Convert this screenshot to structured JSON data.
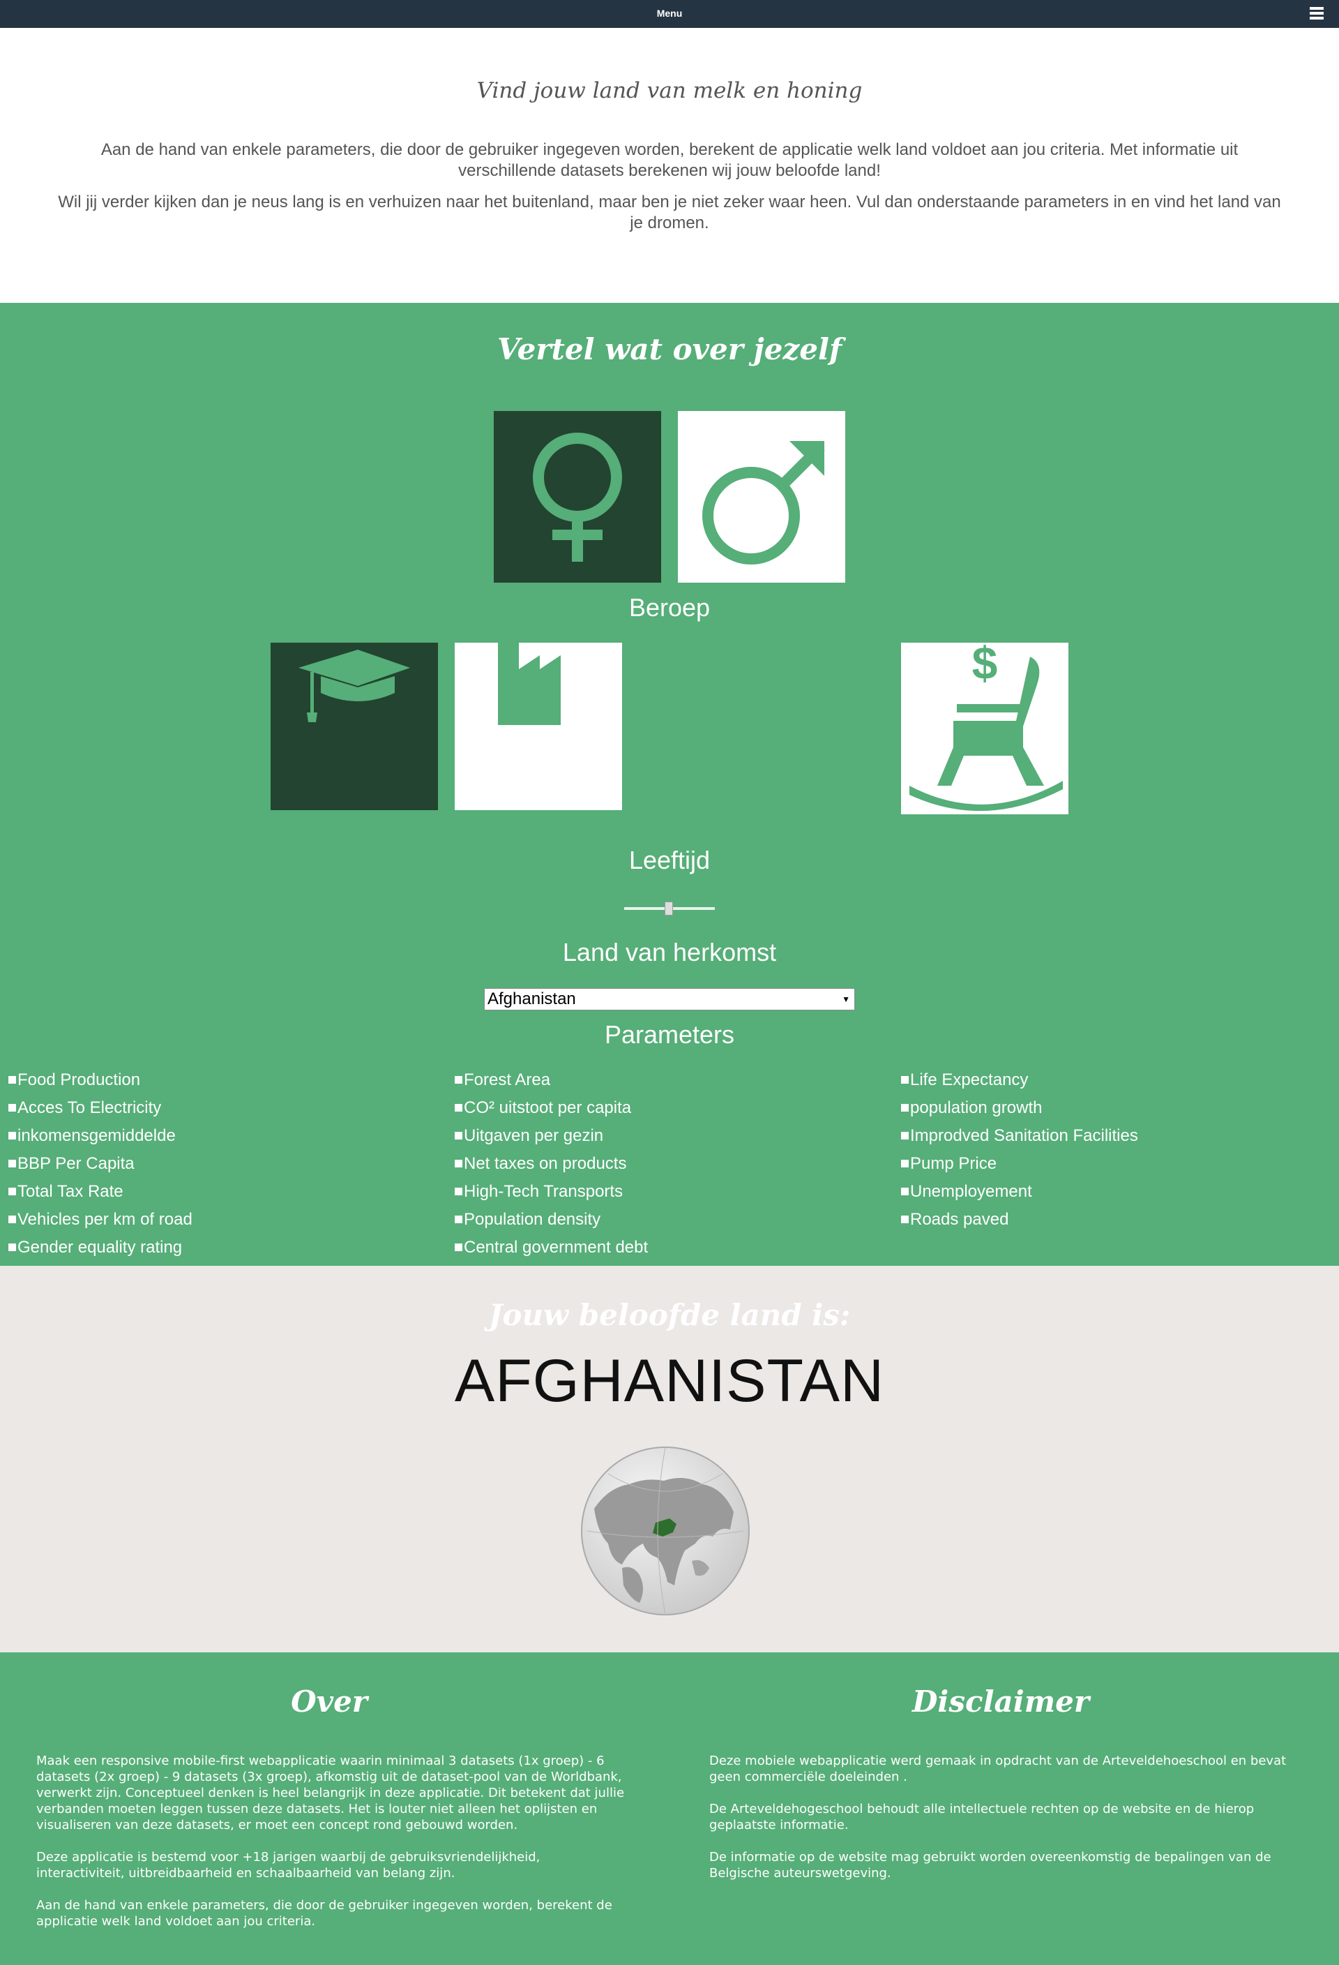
{
  "nav": {
    "menu_label": "Menu",
    "menu_icon": "hamburger-icon"
  },
  "intro": {
    "title": "Vind jouw land van melk en honing",
    "paragraph1": "Aan de hand van enkele parameters, die door de gebruiker ingegeven worden, berekent de applicatie welk land voldoet aan jou criteria. Met informatie uit verschillende datasets berekenen wij jouw beloofde land!",
    "paragraph2": "Wil jij verder kijken dan je neus lang is en verhuizen naar het buitenland, maar ben je niet zeker waar heen. Vul dan onderstaande parameters in en vind het land van je dromen."
  },
  "form": {
    "title": "Vertel wat over jezelf",
    "gender_options": [
      {
        "icon": "female-symbol-icon",
        "selected": true
      },
      {
        "icon": "male-symbol-icon",
        "selected": false
      }
    ],
    "profession_heading": "Beroep",
    "profession_options": [
      {
        "icon": "graduation-cap-icon",
        "selected": true
      },
      {
        "icon": "factory-icon",
        "selected": false
      },
      {
        "icon": "retirement-rocking-chair-icon",
        "selected": false
      }
    ],
    "age_heading": "Leeftijd",
    "age_slider_value": 0.5,
    "origin_heading": "Land van herkomst",
    "origin_selected": "Afghanistan",
    "parameters_heading": "Parameters",
    "parameters": [
      [
        "Food Production",
        "Acces To Electricity",
        "inkomensgemiddelde",
        "BBP Per Capita",
        "Total Tax Rate",
        "Vehicles per km of road",
        "Gender equality rating"
      ],
      [
        "Forest Area",
        "CO² uitstoot per capita",
        "Uitgaven per gezin",
        "Net taxes on products",
        "High-Tech Transports",
        "Population density",
        "Central government debt"
      ],
      [
        "Life Expectancy",
        "population growth",
        "Improdved Sanitation Facilities",
        "Pump Price",
        "Unemployement",
        "Roads paved"
      ]
    ]
  },
  "result": {
    "label": "Jouw beloofde land is:",
    "country": "AFGHANISTAN",
    "globe_icon": "globe-afghanistan-icon"
  },
  "footer": {
    "about_title": "Over",
    "about_paragraphs": [
      "Maak een responsive mobile-first webapplicatie waarin minimaal 3 datasets (1x groep) - 6 datasets (2x groep) - 9 datasets (3x groep), afkomstig uit de dataset-pool van de Worldbank, verwerkt zijn. Conceptueel denken is heel belangrijk in deze applicatie. Dit betekent dat jullie verbanden moeten leggen tussen deze datasets. Het is louter niet alleen het oplijsten en visualiseren van deze datasets, er moet een concept rond gebouwd worden.",
      "Deze applicatie is bestemd voor +18 jarigen waarbij de gebruiksvriendelijkheid, interactiviteit, uitbreidbaarheid en schaalbaarheid van belang zijn.",
      "Aan de hand van enkele parameters, die door de gebruiker ingegeven worden, berekent de applicatie welk land voldoet aan jou criteria."
    ],
    "disclaimer_title": "Disclaimer",
    "disclaimer_paragraphs": [
      "Deze mobiele webapplicatie werd gemaak in opdracht van de Arteveldehoeschool en bevat geen commerciële doeleinden .",
      "De Arteveldehogeschool behoudt alle intellectuele rechten op de website en de hierop geplaatste informatie.",
      "De informatie op de website mag gebruikt worden overeenkomstig de bepalingen van de Belgische auteurswetgeving."
    ]
  },
  "colors": {
    "nav": "#253443",
    "green": "#56ae78",
    "dark_green": "#224430",
    "beige": "#ebe8e6"
  }
}
